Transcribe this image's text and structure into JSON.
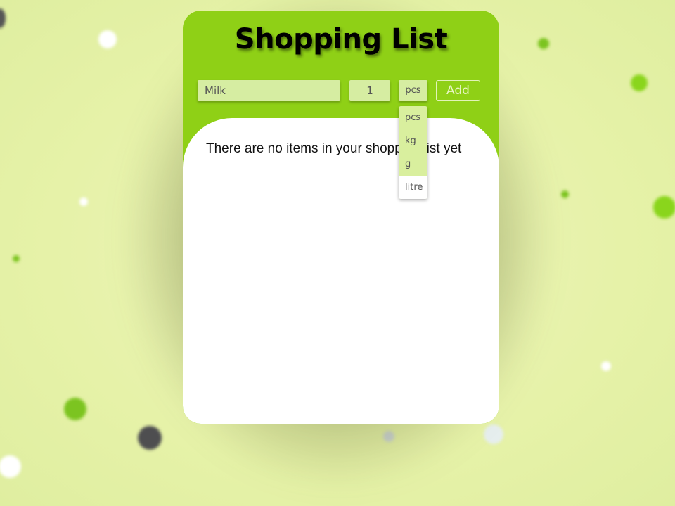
{
  "app": {
    "title": "Shopping List"
  },
  "form": {
    "item_name": {
      "value": "Milk",
      "placeholder": "Milk"
    },
    "quantity": {
      "value": "1"
    },
    "unit": {
      "selected": "pcs",
      "options": [
        "pcs",
        "kg",
        "g",
        "litre"
      ],
      "hovered": "litre",
      "open": true
    },
    "add_label": "Add"
  },
  "list": {
    "empty_message": "There are no items in your shopping list yet",
    "items": []
  },
  "colors": {
    "accent": "#8fd016",
    "input_bg": "#d6eda2",
    "background": "#e6f2a8",
    "panel": "#ffffff"
  }
}
